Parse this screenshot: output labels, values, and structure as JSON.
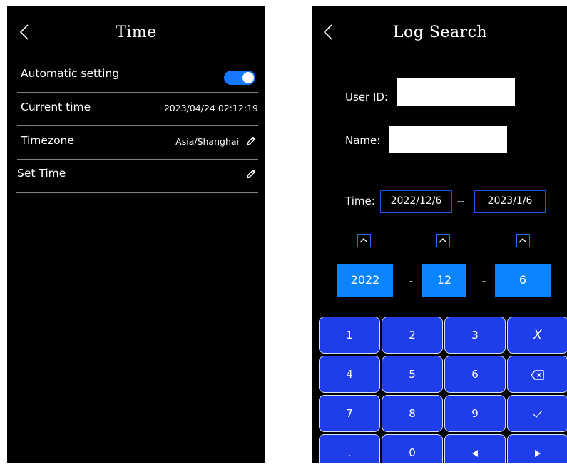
{
  "time_screen": {
    "title": "Time",
    "icons": {
      "back": "chevron-left-icon",
      "edit": "pencil-icon"
    },
    "rows": {
      "automatic": {
        "label": "Automatic setting",
        "toggle_on": true
      },
      "current_time": {
        "label": "Current time",
        "value": "2023/04/24 02:12:19"
      },
      "timezone": {
        "label": "Timezone",
        "value": "Asia/Shanghai"
      },
      "set_time": {
        "label": "Set Time"
      }
    }
  },
  "log_search": {
    "title": "Log Search",
    "user_id": {
      "label": "User ID:",
      "value": ""
    },
    "name": {
      "label": "Name:",
      "value": ""
    },
    "time": {
      "label": "Time:",
      "start": "2022/12/6",
      "separator": "--",
      "end": "2023/1/6"
    },
    "picker": {
      "year": "2022",
      "month": "12",
      "day": "6",
      "separator": "-"
    },
    "keypad": {
      "row1": [
        "1",
        "2",
        "3",
        "X"
      ],
      "row2": [
        "4",
        "5",
        "6"
      ],
      "row3": [
        "7",
        "8",
        "9"
      ],
      "row4": [
        ".",
        "0"
      ]
    },
    "icons": {
      "backspace": "backspace-icon",
      "confirm": "checkmark-icon",
      "left": "arrow-left-icon",
      "right": "arrow-right-icon",
      "up": "chevron-up-icon"
    }
  },
  "colors": {
    "accent": "#0a84ff",
    "keypad": "#1f3eea",
    "background": "#000000"
  }
}
